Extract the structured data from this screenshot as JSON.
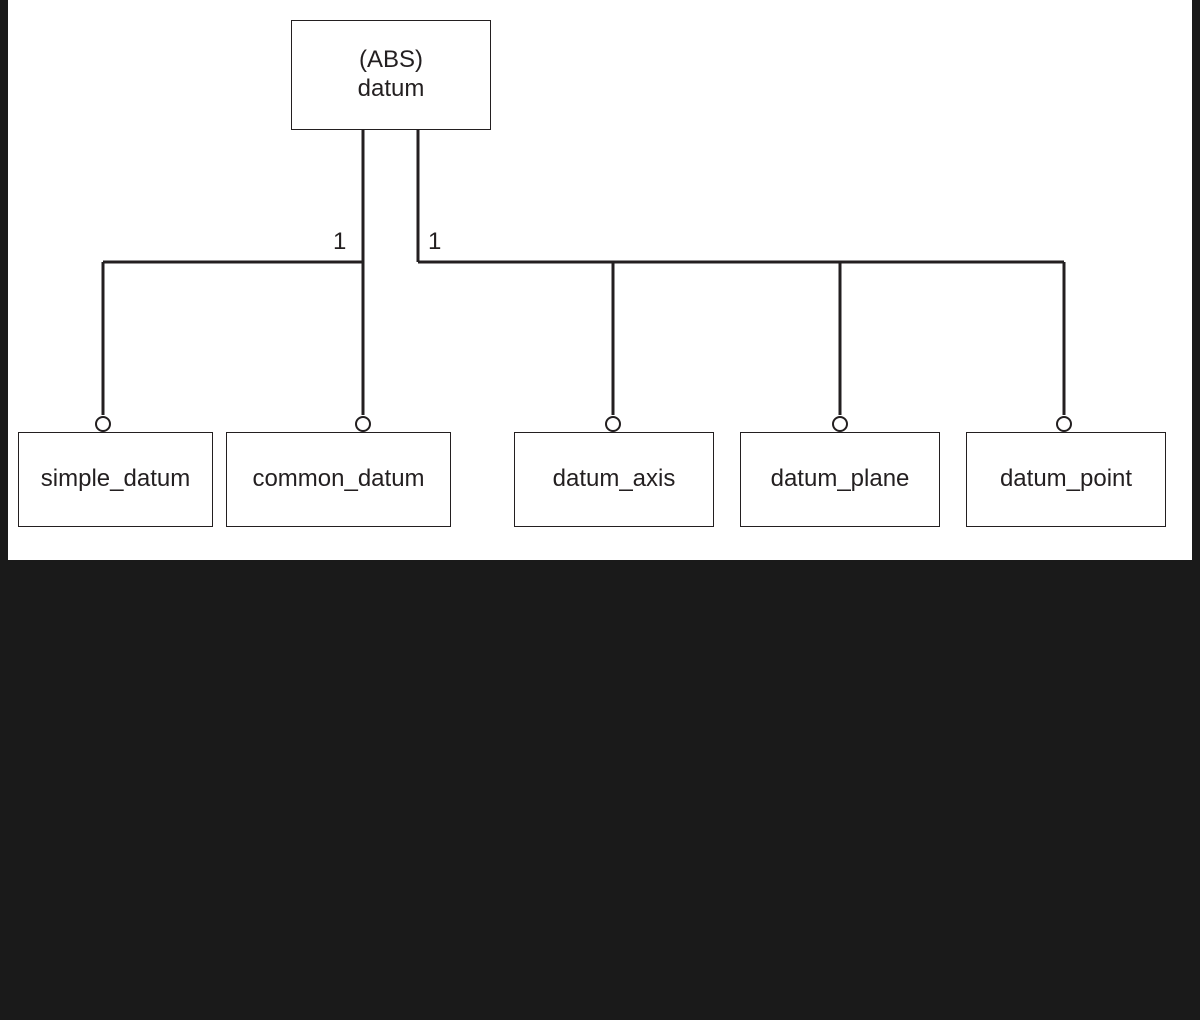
{
  "diagram": {
    "root": {
      "annotation": "(ABS)",
      "name": "datum"
    },
    "labels": {
      "leftOne": "1",
      "rightOne": "1"
    },
    "children": [
      {
        "name": "simple_datum"
      },
      {
        "name": "common_datum"
      },
      {
        "name": "datum_axis"
      },
      {
        "name": "datum_plane"
      },
      {
        "name": "datum_point"
      }
    ]
  }
}
